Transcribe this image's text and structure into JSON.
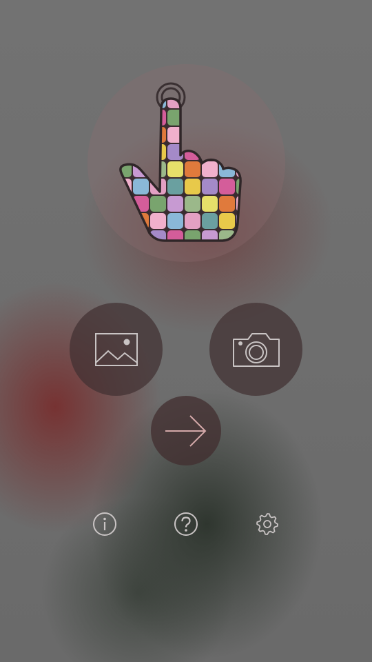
{
  "colors": {
    "icon_stroke": "#c9c4c4",
    "arrow_stroke": "#d4a9a9",
    "hand_outline": "#2f2628",
    "tiles": [
      "#e3a0c3",
      "#9bb88a",
      "#e8c94a",
      "#e07a3c",
      "#d45d9a",
      "#8ab8d8",
      "#c79ad2",
      "#6aa0a0",
      "#e6e06a",
      "#a48ac8",
      "#f0b0cc",
      "#79a46e"
    ]
  },
  "icons": {
    "hero": "colorful-tapping-hand-icon",
    "gallery": "image-gallery-icon",
    "camera": "camera-icon",
    "next": "arrow-right-icon",
    "info": "info-icon",
    "help": "help-icon",
    "settings": "gear-icon"
  }
}
